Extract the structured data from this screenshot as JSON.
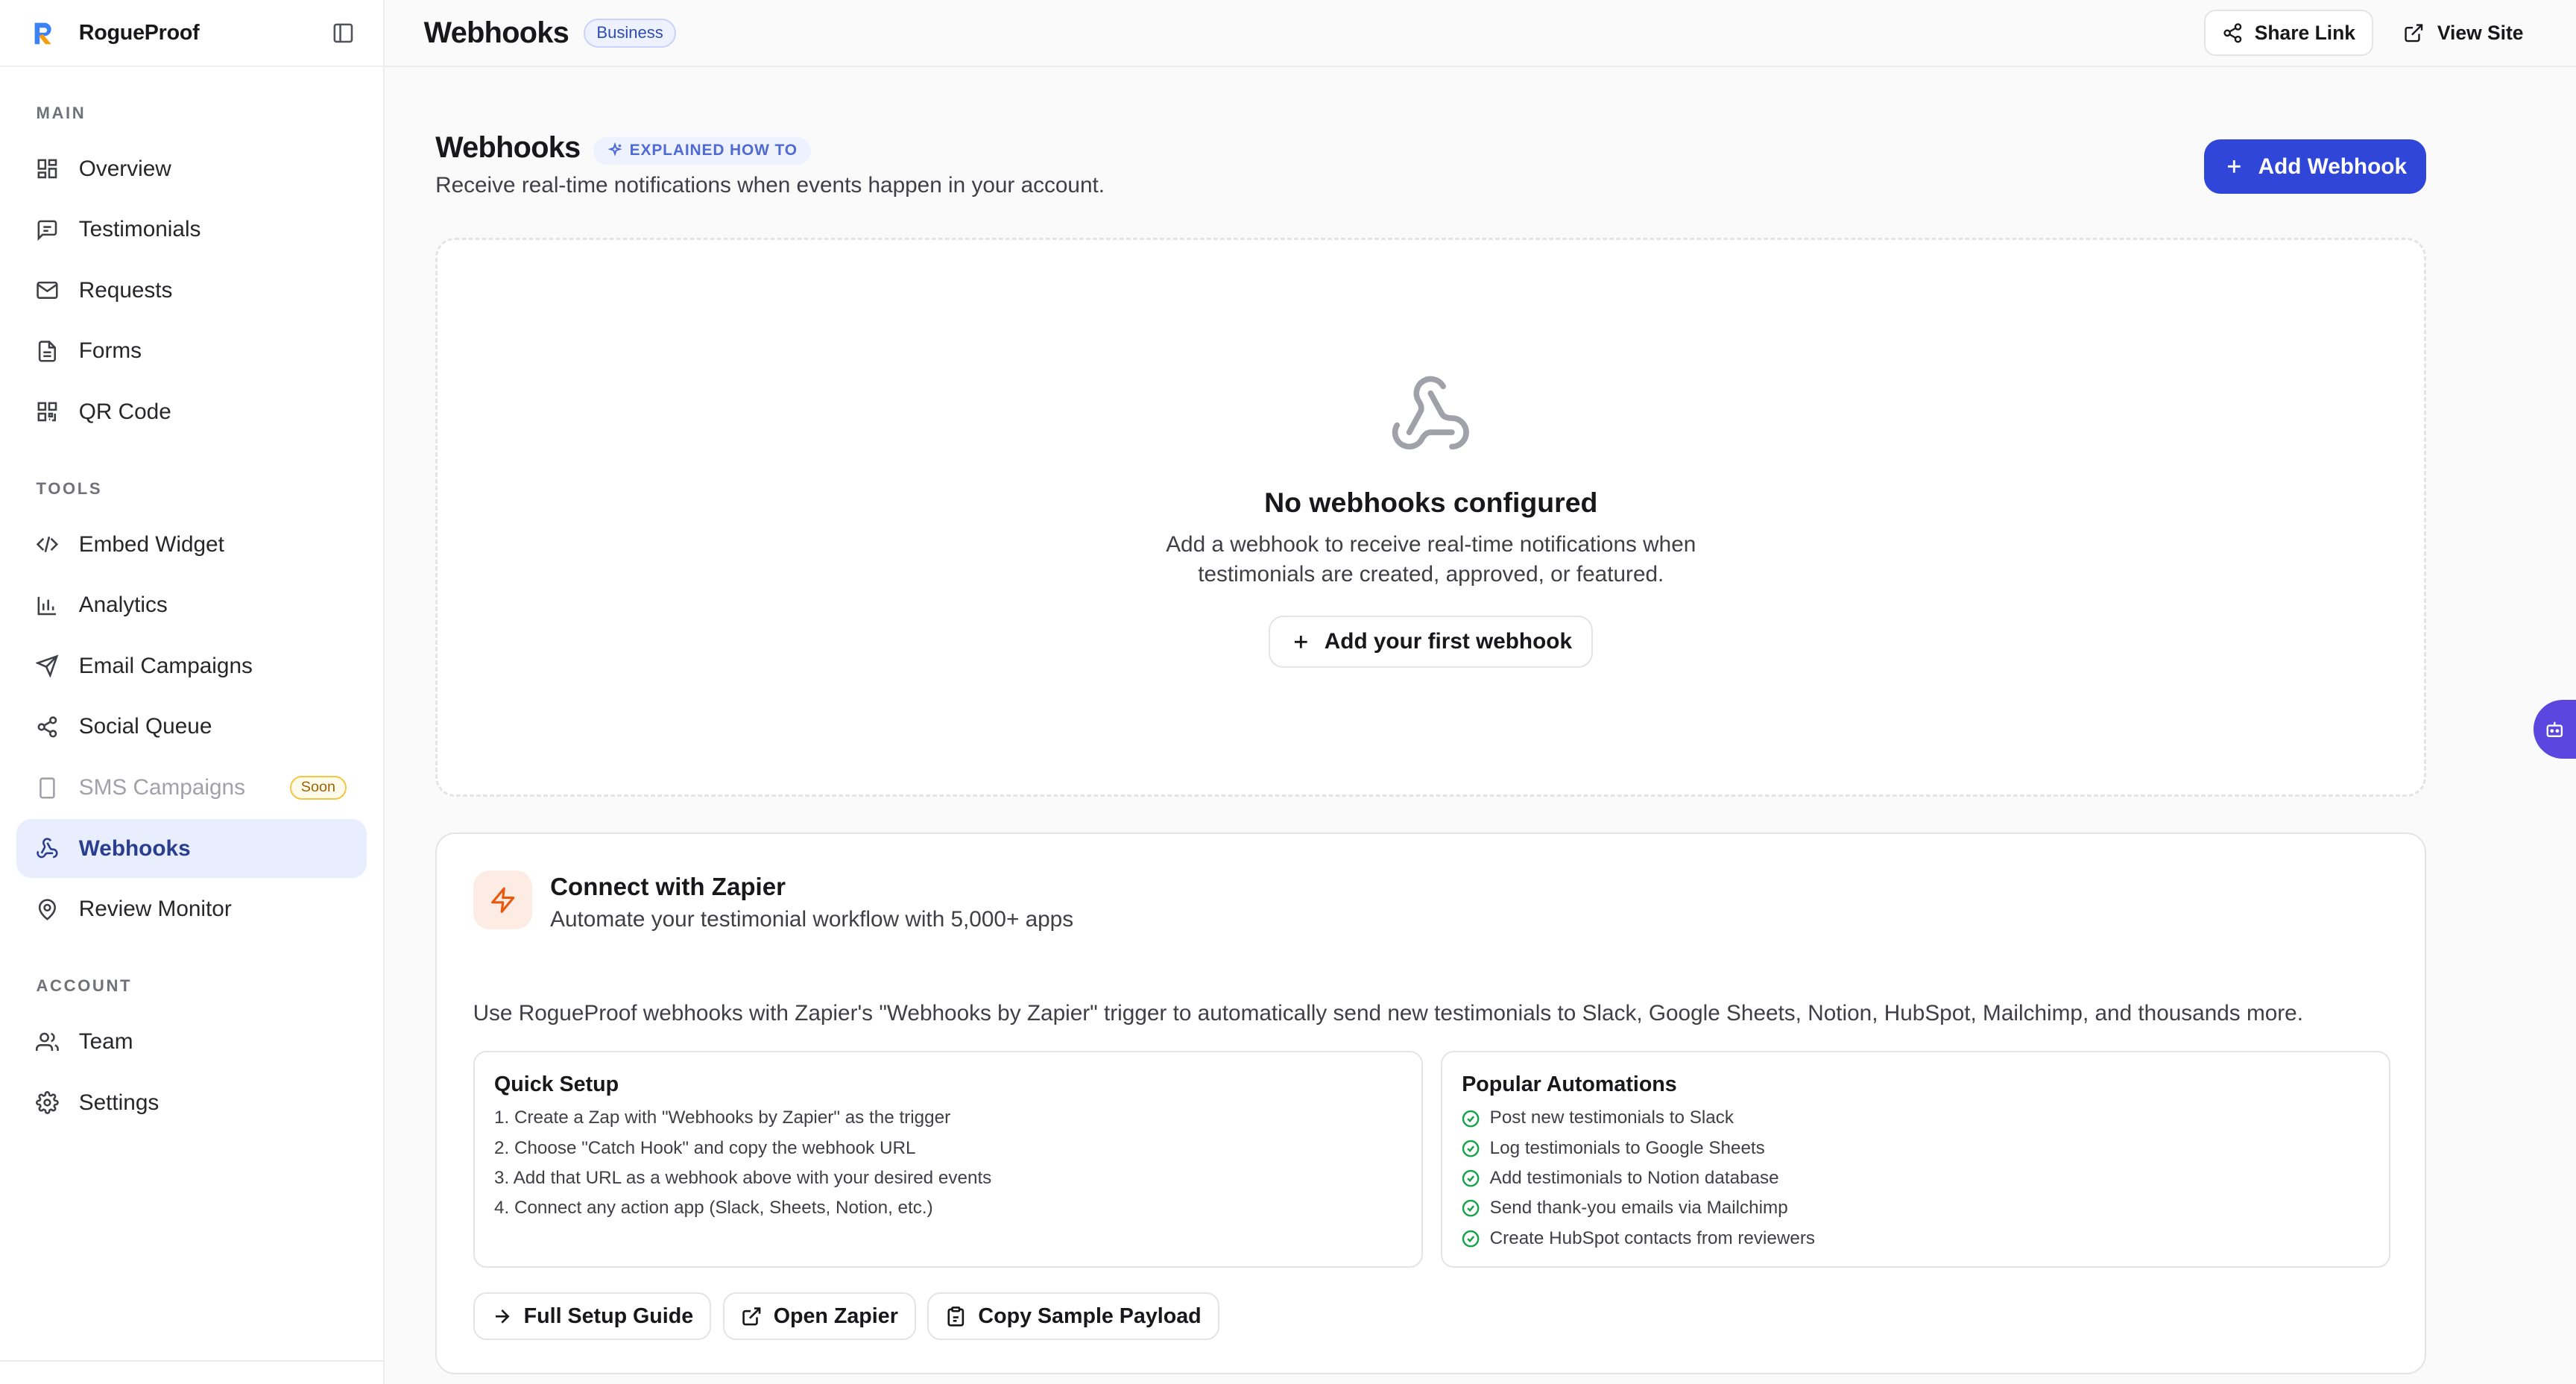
{
  "app": {
    "name": "RogueProof",
    "colors": {
      "accent": "#2f46d8",
      "active_bg": "#e8eefd",
      "zapier": "#ea580c"
    }
  },
  "sidebar": {
    "sections": [
      {
        "label": "MAIN",
        "items": [
          {
            "label": "Overview",
            "icon": "grid-icon"
          },
          {
            "label": "Testimonials",
            "icon": "message-square-icon"
          },
          {
            "label": "Requests",
            "icon": "mail-icon"
          },
          {
            "label": "Forms",
            "icon": "file-text-icon"
          },
          {
            "label": "QR Code",
            "icon": "qr-code-icon"
          }
        ]
      },
      {
        "label": "TOOLS",
        "items": [
          {
            "label": "Embed Widget",
            "icon": "code-icon"
          },
          {
            "label": "Analytics",
            "icon": "bar-chart-icon"
          },
          {
            "label": "Email Campaigns",
            "icon": "send-icon"
          },
          {
            "label": "Social Queue",
            "icon": "share-icon"
          },
          {
            "label": "SMS Campaigns",
            "icon": "smartphone-icon",
            "badge": "Soon",
            "disabled": true
          },
          {
            "label": "Webhooks",
            "icon": "webhook-icon",
            "active": true
          },
          {
            "label": "Review Monitor",
            "icon": "map-pin-icon"
          }
        ]
      },
      {
        "label": "ACCOUNT",
        "items": [
          {
            "label": "Team",
            "icon": "users-icon"
          },
          {
            "label": "Settings",
            "icon": "gear-icon"
          }
        ]
      }
    ]
  },
  "topbar": {
    "title": "Webhooks",
    "plan": "Business",
    "share_label": "Share Link",
    "view_label": "View Site"
  },
  "page": {
    "title": "Webhooks",
    "explain_label": "EXPLAINED HOW TO",
    "subtitle": "Receive real-time notifications when events happen in your account.",
    "add_label": "Add Webhook"
  },
  "empty": {
    "title": "No webhooks configured",
    "description": "Add a webhook to receive real-time notifications when testimonials are created, approved, or featured.",
    "cta": "Add your first webhook"
  },
  "zapier": {
    "title": "Connect with Zapier",
    "subtitle": "Automate your testimonial workflow with 5,000+ apps",
    "description": "Use RogueProof webhooks with Zapier's \"Webhooks by Zapier\" trigger to automatically send new testimonials to Slack, Google Sheets, Notion, HubSpot, Mailchimp, and thousands more.",
    "quick_setup": {
      "title": "Quick Setup",
      "steps": [
        "1. Create a Zap with \"Webhooks by Zapier\" as the trigger",
        "2. Choose \"Catch Hook\" and copy the webhook URL",
        "3. Add that URL as a webhook above with your desired events",
        "4. Connect any action app (Slack, Sheets, Notion, etc.)"
      ]
    },
    "popular": {
      "title": "Popular Automations",
      "items": [
        "Post new testimonials to Slack",
        "Log testimonials to Google Sheets",
        "Add testimonials to Notion database",
        "Send thank-you emails via Mailchimp",
        "Create HubSpot contacts from reviewers"
      ]
    },
    "buttons": {
      "guide": "Full Setup Guide",
      "open": "Open Zapier",
      "copy": "Copy Sample Payload"
    }
  }
}
